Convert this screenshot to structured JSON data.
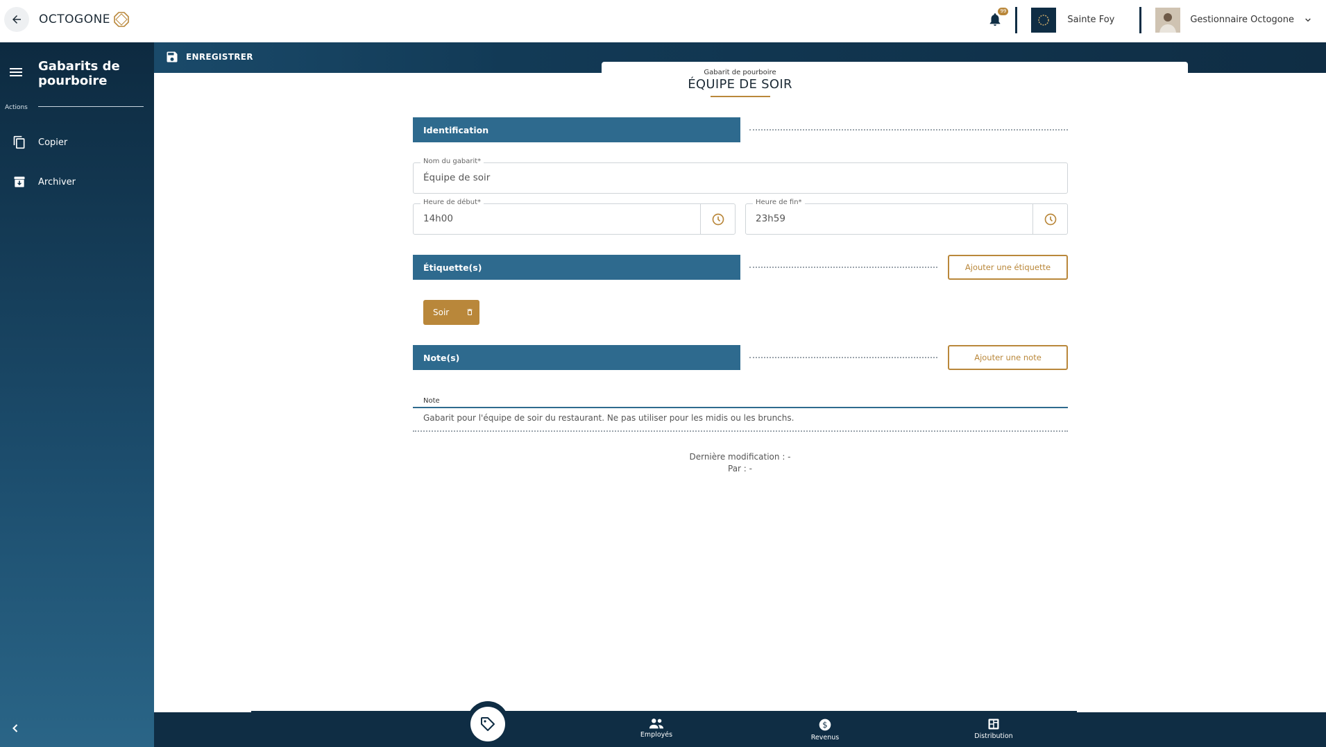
{
  "header": {
    "logo_text": "OCTOGONE",
    "notification_count": "99",
    "site_name": "Sainte Foy",
    "user_name": "Gestionnaire Octogone"
  },
  "sidebar": {
    "title": "Gabarits de pourboire",
    "actions_label": "Actions",
    "items": [
      {
        "label": "Copier",
        "icon": "copy-icon"
      },
      {
        "label": "Archiver",
        "icon": "archive-icon"
      }
    ]
  },
  "toolbar": {
    "save_label": "ENREGISTRER"
  },
  "form": {
    "pre_title": "Gabarit de pourboire",
    "title": "ÉQUIPE DE SOIR",
    "identification_label": "Identification",
    "name_label": "Nom du gabarit*",
    "name_value": "Équipe de soir",
    "start_label": "Heure de début*",
    "start_value": "14h00",
    "end_label": "Heure de fin*",
    "end_value": "23h59",
    "tags_label": "Étiquette(s)",
    "add_tag_label": "Ajouter une étiquette",
    "tags": [
      "Soir"
    ],
    "notes_label": "Note(s)",
    "add_note_label": "Ajouter une note",
    "note_header": "Note",
    "note_text": "Gabarit pour l'équipe de soir du restaurant. Ne pas utiliser pour les midis ou les brunchs.",
    "last_modified": "Dernière modification :  -",
    "by": "Par :  -"
  },
  "bottom_nav": {
    "items": [
      {
        "label": "Employés",
        "icon": "people-icon"
      },
      {
        "label": "Revenus",
        "icon": "dollar-icon"
      },
      {
        "label": "Distribution",
        "icon": "dashboard-icon"
      }
    ]
  },
  "colors": {
    "navy": "#0f2d44",
    "section_blue": "#2e6a8e",
    "gold": "#b9873a"
  }
}
